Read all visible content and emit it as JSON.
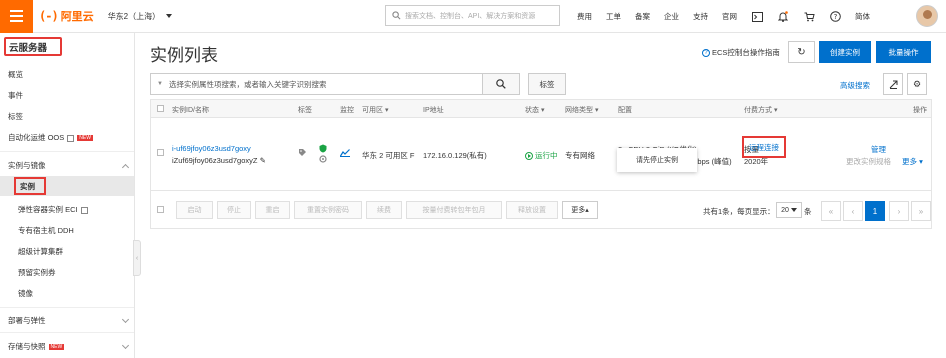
{
  "header": {
    "logo_mark": "(-)",
    "logo_text": "阿里云",
    "region": "华东2（上海）",
    "search_placeholder": "搜索文档、控制台、API、解决方案和资源",
    "nav": [
      "费用",
      "工单",
      "备案",
      "企业",
      "支持",
      "官网"
    ],
    "lang": "简体"
  },
  "sidebar": {
    "title": "云服务器",
    "items": [
      "概览",
      "事件",
      "标签",
      "自动化运维 OOS"
    ],
    "new_badge": "NEW",
    "group_instances": "实例与镜像",
    "active_item": "实例",
    "sub_items": [
      "弹性容器实例 ECI",
      "专有宿主机 DDH",
      "超级计算集群",
      "预留实例券",
      "镜像"
    ],
    "group_deploy": "部署与弹性",
    "group_storage": "存储与快照"
  },
  "main": {
    "title": "实例列表",
    "guide_link": "ECS控制台操作指南",
    "refresh_icon": "↻",
    "create_button": "创建实例",
    "batch_button": "批量操作",
    "filter_placeholder": "选择实例属性项搜索，或者输入关键字识别搜索",
    "tag_button": "标签",
    "advanced_search": "高级搜索"
  },
  "table": {
    "headers": {
      "id": "实例ID/名称",
      "tag": "标签",
      "monitor": "监控",
      "zone": "可用区",
      "ip": "IP地址",
      "status": "状态",
      "network": "网络类型",
      "config": "配置",
      "billing": "付费方式",
      "ops": "操作"
    },
    "row": {
      "id": "i-uf69jfoy06z3usd7goxy",
      "name": "iZuf69jfoy06z3usd7goxyZ",
      "zone": "华东 2 可用区 F",
      "ip": "172.16.0.129(私有)",
      "status": "运行中",
      "network": "专有网络",
      "config_line1": "2 vCPU 2 GiB (I/O优化)",
      "config_type": "ecs.t6-c1m1.large",
      "bandwidth": "0Mbps (峰值)",
      "billing_line1": "按量",
      "billing_line2": "2020年",
      "manage": "管理",
      "remote": "远程连接",
      "change_spec": "更改实例规格",
      "more": "更多"
    },
    "tooltip": "请先停止实例",
    "footer_buttons": [
      "启动",
      "停止",
      "重启",
      "重置实例密码",
      "续费",
      "按量付费转包年包月",
      "释放设置"
    ],
    "footer_more": "更多▴",
    "pager_info": "共有1条，每页显示：",
    "page_size": "20",
    "page_size_unit": "条",
    "pages": [
      "«",
      "‹",
      "1",
      "›",
      "»"
    ]
  }
}
